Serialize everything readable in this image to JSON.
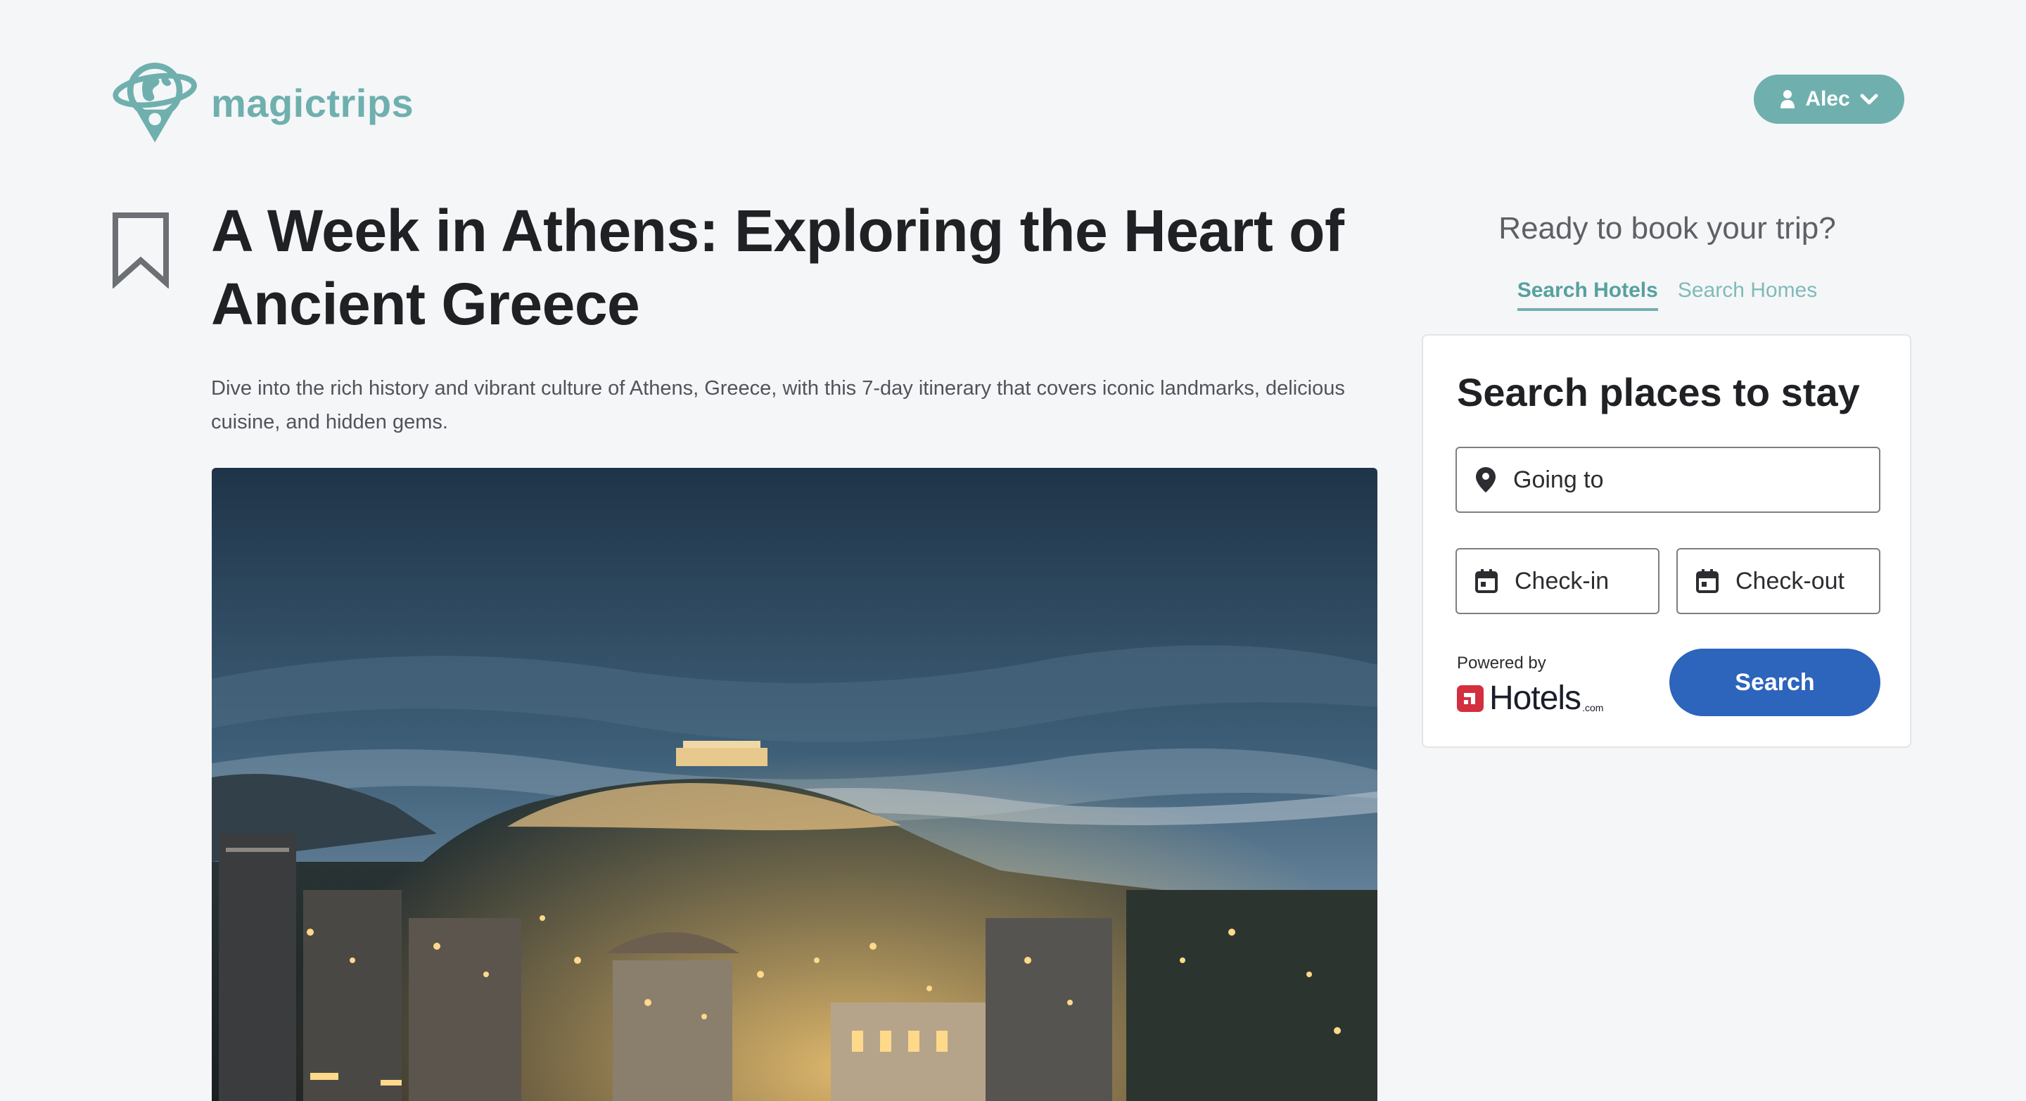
{
  "header": {
    "brand": "magictrips",
    "user_name": "Alec"
  },
  "article": {
    "title": "A Week in Athens: Exploring the Heart of Ancient Greece",
    "description": "Dive into the rich history and vibrant culture of Athens, Greece, with this 7-day itinerary that covers iconic landmarks, delicious cuisine, and hidden gems."
  },
  "booking": {
    "heading": "Ready to book your trip?",
    "tabs": [
      {
        "label": "Search Hotels",
        "active": true
      },
      {
        "label": "Search Homes",
        "active": false
      }
    ],
    "card_title": "Search places to stay",
    "going_to_placeholder": "Going to",
    "checkin_placeholder": "Check-in",
    "checkout_placeholder": "Check-out",
    "powered_by": "Powered by",
    "partner_name": "Hotels",
    "partner_suffix": ".com",
    "search_label": "Search"
  },
  "icons": {
    "logo": "globe-pin-icon",
    "user": "user-icon",
    "dropdown": "chevron-down-icon",
    "bookmark": "bookmark-icon",
    "location": "location-pin-icon",
    "calendar": "calendar-icon",
    "partner": "hotels-logo-icon"
  },
  "colors": {
    "brand_teal": "#6fb0ae",
    "search_button": "#2d64bc",
    "partner_red": "#d32f3f",
    "background": "#f5f6f8"
  }
}
